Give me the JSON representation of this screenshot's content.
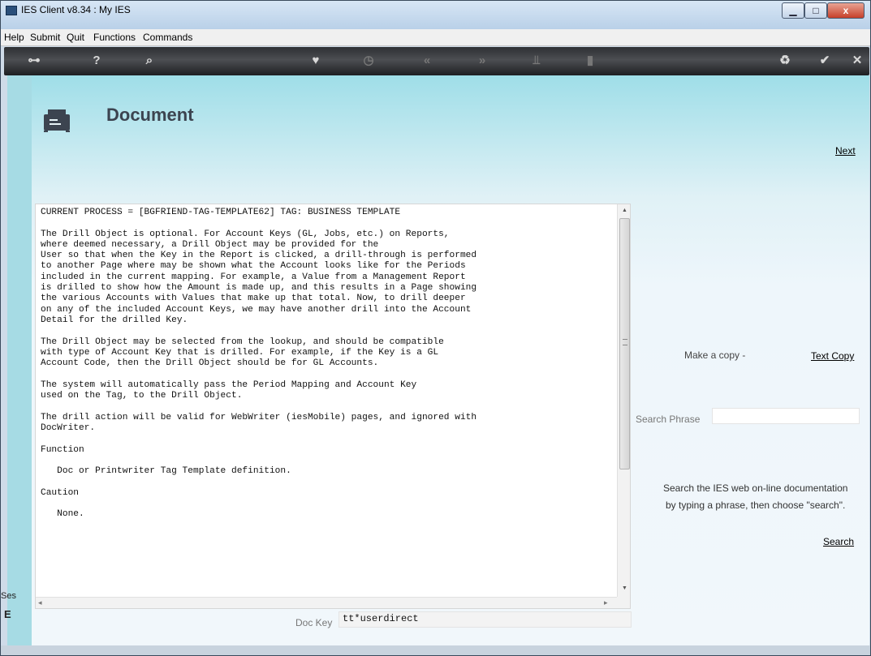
{
  "window": {
    "title": "IES Client v8.34 : My IES",
    "controls": {
      "minimize": "▁",
      "maximize": "□",
      "close": "x"
    }
  },
  "menu": {
    "items": [
      "Help",
      "Submit",
      "Quit",
      "Functions",
      "Commands"
    ]
  },
  "toolbar": {
    "icons": [
      {
        "name": "key-icon",
        "glyph": "⊶",
        "enabled": true
      },
      {
        "name": "help-icon",
        "glyph": "?",
        "enabled": true
      },
      {
        "name": "search-icon",
        "glyph": "⌕",
        "enabled": true
      },
      {
        "name": "heart-icon",
        "glyph": "♥",
        "enabled": true
      },
      {
        "name": "clock-icon",
        "glyph": "◷",
        "enabled": false
      },
      {
        "name": "back-icon",
        "glyph": "«",
        "enabled": false
      },
      {
        "name": "forward-icon",
        "glyph": "»",
        "enabled": false
      },
      {
        "name": "tools-icon",
        "glyph": "⫫",
        "enabled": false
      },
      {
        "name": "panel-icon",
        "glyph": "▮",
        "enabled": false
      },
      {
        "name": "recycle-icon",
        "glyph": "♻",
        "enabled": true
      },
      {
        "name": "check-icon",
        "glyph": "✔",
        "enabled": true
      },
      {
        "name": "close-icon",
        "glyph": "✕",
        "enabled": true
      }
    ]
  },
  "page": {
    "title": "Document",
    "next_link": "Next",
    "document_text": "CURRENT PROCESS = [BGFRIEND-TAG-TEMPLATE62] TAG: BUSINESS TEMPLATE\n\nThe Drill Object is optional. For Account Keys (GL, Jobs, etc.) on Reports,\nwhere deemed necessary, a Drill Object may be provided for the\nUser so that when the Key in the Report is clicked, a drill-through is performed\nto another Page where may be shown what the Account looks like for the Periods\nincluded in the current mapping. For example, a Value from a Management Report\nis drilled to show how the Amount is made up, and this results in a Page showing\nthe various Accounts with Values that make up that total. Now, to drill deeper\non any of the included Account Keys, we may have another drill into the Account\nDetail for the drilled Key.\n\nThe Drill Object may be selected from the lookup, and should be compatible\nwith type of Account Key that is drilled. For example, if the Key is a GL\nAccount Code, then the Drill Object should be for GL Accounts.\n\nThe system will automatically pass the Period Mapping and Account Key\nused on the Tag, to the Drill Object.\n\nThe drill action will be valid for WebWriter (iesMobile) pages, and ignored with\nDocWriter.\n\nFunction\n\n   Doc or Printwriter Tag Template definition.\n\nCaution\n\n   None.",
    "copy_label": "Make a copy -",
    "text_copy_link": "Text Copy",
    "search_label": "Search Phrase",
    "search_value": "",
    "search_help_1": "Search the IES web on-line documentation",
    "search_help_2": "by typing a phrase, then choose \"search\".",
    "search_link": "Search",
    "dockey_label": "Doc Key",
    "dockey_value": "tt*userdirect",
    "session_label": "Ses",
    "session_glyph": "E"
  },
  "colors": {
    "toolbar_bg": "#3a3c40",
    "header_gradient_top": "#9fdee8",
    "page_bg": "#eef6fb"
  }
}
